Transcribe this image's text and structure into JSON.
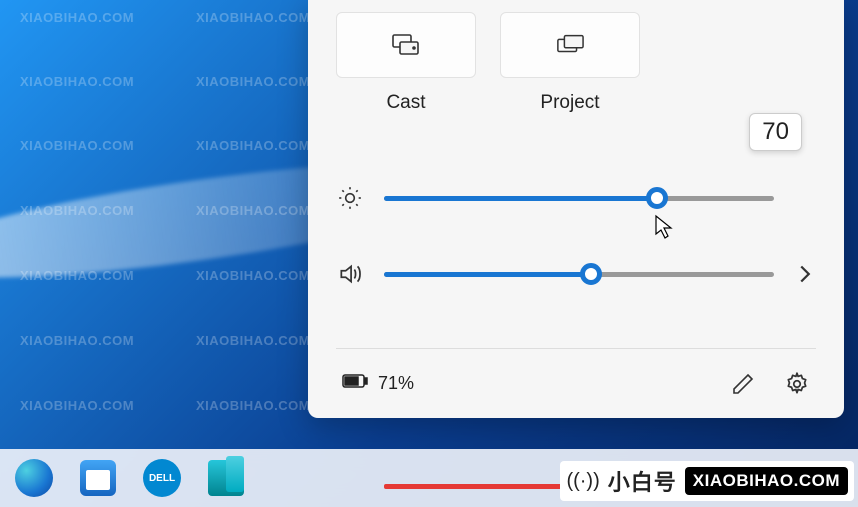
{
  "tiles": {
    "cast": {
      "label": "Cast"
    },
    "project": {
      "label": "Project"
    }
  },
  "brightness": {
    "value": 70,
    "tooltip": "70"
  },
  "volume": {
    "value": 53
  },
  "battery": {
    "percent_label": "71%"
  },
  "watermark": {
    "domain": "XIAOBIHAO.COM",
    "cn": "@小白号"
  },
  "logo": {
    "cn_text": "小白号",
    "badge": "XIAOBIHAO.COM"
  },
  "taskbar": {
    "dell_label": "DELL"
  }
}
